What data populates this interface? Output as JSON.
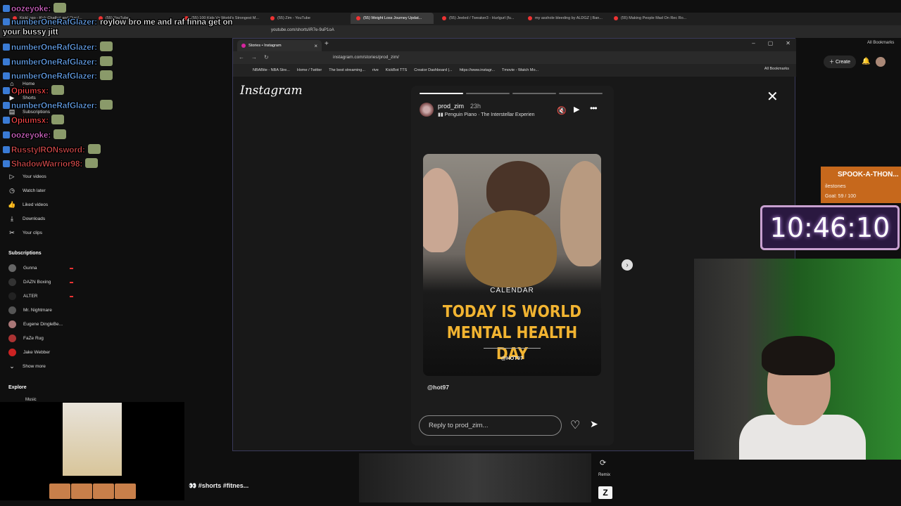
{
  "bg_browser": {
    "tabs": [
      {
        "label": "KickLogo - Kick Chatbot and Overl..."
      },
      {
        "label": "(55) YouTube"
      },
      {
        "label": "(55) 100 Kids Vs World's Strongest M..."
      },
      {
        "label": "(55) Zim - YouTube"
      },
      {
        "label": "(55) Weight Loss Journey Updat..."
      },
      {
        "label": "(55) Jeeled / Tweaker3 - Hurlgurl (fu..."
      },
      {
        "label": "my asshole bleeding by ALDGZ | Ban..."
      },
      {
        "label": "(55) Making People Mad On Rec Ro..."
      }
    ],
    "url": "youtube.com/shorts/iR7e-9uP1oA",
    "all_bookmarks": "All Bookmarks"
  },
  "chat": [
    {
      "user": "oozeyoke:",
      "text": "",
      "color": "#e86fd8"
    },
    {
      "user": "numberOneRafGlazer:",
      "text": "roylow bro me and raf finna get on your bussy jitt",
      "color": "#6fb0ff"
    },
    {
      "user": "numberOneRafGlazer:",
      "text": "",
      "color": "#6fb0ff"
    },
    {
      "user": "numberOneRafGlazer:",
      "text": "",
      "color": "#6fb0ff"
    },
    {
      "user": "numberOneRafGlazer:",
      "text": "",
      "color": "#6fb0ff"
    },
    {
      "user": "Opiumsx:",
      "text": "",
      "color": "#ff4a4a"
    },
    {
      "user": "numberOneRafGlazer:",
      "text": "",
      "color": "#6fb0ff"
    },
    {
      "user": "Opiumsx:",
      "text": "",
      "color": "#ff4a4a"
    },
    {
      "user": "oozeyoke:",
      "text": "",
      "color": "#e86fd8"
    },
    {
      "user": "RusstyIRONsword:",
      "text": "",
      "color": "#e05050"
    },
    {
      "user": "ShadowWarrior98:",
      "text": "",
      "color": "#e05050"
    }
  ],
  "yt_sidebar": {
    "items": [
      {
        "label": "Home",
        "icon": "home-icon"
      },
      {
        "label": "Shorts",
        "icon": "shorts-icon"
      },
      {
        "label": "Subscriptions",
        "icon": "subscriptions-icon"
      },
      {
        "label": "Your videos",
        "icon": "play-icon"
      },
      {
        "label": "Watch later",
        "icon": "clock-icon"
      },
      {
        "label": "Liked videos",
        "icon": "thumbs-up-icon"
      },
      {
        "label": "Downloads",
        "icon": "download-icon"
      },
      {
        "label": "Your clips",
        "icon": "scissors-icon"
      }
    ],
    "subscriptions_title": "Subscriptions",
    "subscriptions": [
      {
        "name": "Gunna",
        "live": true
      },
      {
        "name": "DAZN Boxing",
        "live": true
      },
      {
        "name": "ALTER",
        "live": true
      },
      {
        "name": "Mr. Nightmare",
        "live": false
      },
      {
        "name": "Eugene DingleBe...",
        "live": false
      },
      {
        "name": "FaZe Rug",
        "live": false
      },
      {
        "name": "Jake Webber",
        "live": false
      }
    ],
    "show_more": "Show more",
    "explore": "Explore",
    "music": "Music"
  },
  "yt_header": {
    "create": "Create",
    "notif_count": "9+"
  },
  "window": {
    "tab_title": "Stories • Instagram",
    "url": "instagram.com/stories/prod_zim/",
    "bookmarks": [
      "NBABite - NBA Stre...",
      "Home / Twitter",
      "The best streaming...",
      "rive",
      "KickBot TTS",
      "Creator Dashboard |...",
      "https://www.instagr...",
      "Tmovie - Watch Mo..."
    ],
    "all_bookmarks": "All Bookmarks"
  },
  "instagram": {
    "logo": "Instagram",
    "story": {
      "username": "prod_zim",
      "time": "23h",
      "song": "Penguin Piano · The Interstellar Experien",
      "calendar": "CALENDAR",
      "headline_line1": "TODAY IS WORLD",
      "headline_line2": "MENTAL HEALTH DAY",
      "handle": "@HOT97",
      "mention": "@hot97",
      "reply_placeholder": "Reply to prod_zim...",
      "progress_segments": 4,
      "active_segment": 1
    }
  },
  "overlay": {
    "spook_title": "SPOOK-A-THON...",
    "spook_sub": "ilestones",
    "spook_goal": "Goal: 59 / 100",
    "timer": "10:46:10"
  },
  "short": {
    "title": "👀 #shorts #fitnes...",
    "remix": "Remix"
  },
  "colors": {
    "accent_gold": "#f2b431",
    "live_red": "#e33333"
  }
}
